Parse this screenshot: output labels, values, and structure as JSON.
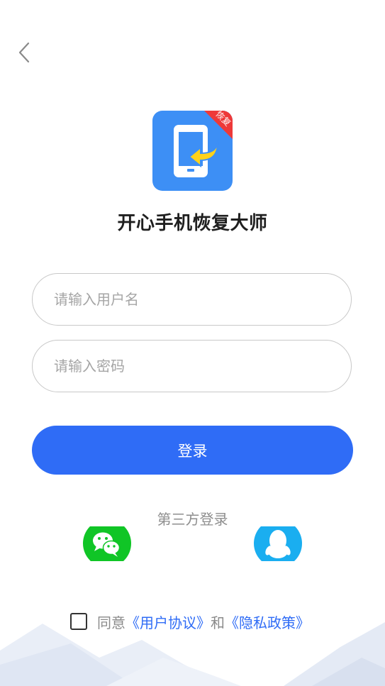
{
  "app": {
    "name": "开心手机恢复大师",
    "logo_badge": "恢复"
  },
  "form": {
    "username_placeholder": "请输入用户名",
    "password_placeholder": "请输入密码",
    "login_label": "登录"
  },
  "third_party": {
    "label": "第三方登录",
    "providers": [
      {
        "name": "WeChat",
        "icon": "wechat-icon",
        "color": "#10c526"
      },
      {
        "name": "QQ",
        "icon": "qq-icon",
        "color": "#1aaef0"
      }
    ]
  },
  "agreement": {
    "checked": false,
    "prefix": "同意",
    "user_agreement": "《用户协议》",
    "conjunction": "和",
    "privacy_policy": "《隐私政策》"
  },
  "colors": {
    "primary": "#2f6cf6",
    "logo_bg": "#3d8ff5",
    "badge": "#ee3939",
    "wechat": "#10c526",
    "qq": "#1aaef0"
  }
}
